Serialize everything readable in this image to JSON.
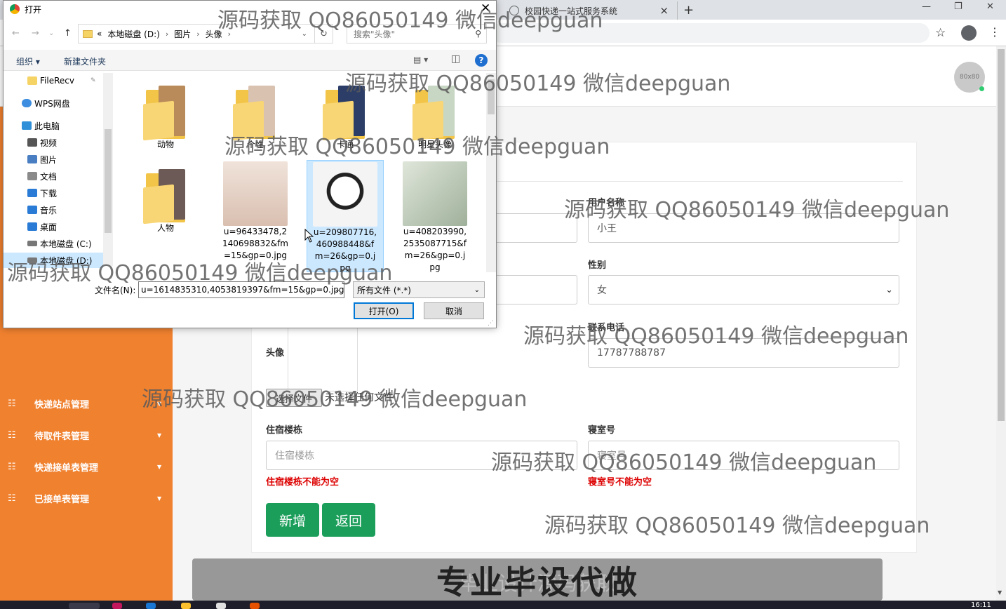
{
  "browser": {
    "tab_title": "校园快递一站式服务系统",
    "close_glyph": "×",
    "new_tab_glyph": "+",
    "min_glyph": "—",
    "max_glyph": "❐",
    "win_close_glyph": "✕",
    "star_glyph": "☆",
    "menu_glyph": "⋮"
  },
  "header": {
    "avatar_text": "80x80"
  },
  "sidebar": {
    "items": [
      {
        "label": "快递站点管理",
        "icon": "grid-icon"
      },
      {
        "label": "待取件表管理",
        "icon": "grid-icon"
      },
      {
        "label": "快递接单表管理",
        "icon": "grid-icon"
      },
      {
        "label": "已接单表管理",
        "icon": "grid-icon"
      }
    ],
    "item_glyph": "☷",
    "caret_glyph": "▼"
  },
  "form": {
    "username_label": "用户名称",
    "username_value": "小王",
    "gender_label": "性别",
    "gender_value": "女",
    "phone_label": "联系电话",
    "phone_value": "17787788787",
    "avatar_label": "头像",
    "choose_file": "选择文件",
    "no_file": "未选择任何文件",
    "building_label": "住宿楼栋",
    "building_placeholder": "住宿楼栋",
    "building_error": "住宿楼栋不能为空",
    "room_label": "寝室号",
    "room_placeholder": "寝室号",
    "room_error": "寝室号不能为空",
    "add_button": "新增",
    "back_button": "返回",
    "select_chevron": "⌄"
  },
  "banner": {
    "text": "专业毕设代做",
    "ghost": "毕业设计源码获取"
  },
  "taskbar": {
    "clock": "16:11",
    "accent": "#1e1e2a"
  },
  "dialog": {
    "title": "打开",
    "close_glyph": "✕",
    "nav": {
      "back": "←",
      "forward": "→",
      "recent": "⌄",
      "up": "↑"
    },
    "path": [
      "本地磁盘 (D:)",
      "图片",
      "头像"
    ],
    "path_prefix": "«",
    "path_sep": "›",
    "refresh_glyph": "↻",
    "search_placeholder": "搜索\"头像\"",
    "search_glyph": "⚲",
    "toolbar": {
      "organize": "组织 ▾",
      "new_folder": "新建文件夹",
      "view_glyph": "▤ ▾",
      "pane_glyph": "◫",
      "help": "?"
    },
    "nav_items": [
      {
        "label": "FileRecv",
        "icon": "folder-icon",
        "color": "#f6d365",
        "pin": "📌"
      },
      {
        "label": "WPS网盘",
        "icon": "cloud-icon",
        "color": "#3d8ee0"
      },
      {
        "label": "此电脑",
        "icon": "computer-icon",
        "color": "#2f8fd8"
      },
      {
        "label": "视频",
        "icon": "video-icon",
        "color": "#555"
      },
      {
        "label": "图片",
        "icon": "pictures-icon",
        "color": "#4a7ec2"
      },
      {
        "label": "文档",
        "icon": "document-icon",
        "color": "#8a8a8a"
      },
      {
        "label": "下载",
        "icon": "download-icon",
        "color": "#2a7bd6"
      },
      {
        "label": "音乐",
        "icon": "music-icon",
        "color": "#2a7bd6"
      },
      {
        "label": "桌面",
        "icon": "desktop-icon",
        "color": "#2a7bd6"
      },
      {
        "label": "本地磁盘 (C:)",
        "icon": "drive-icon",
        "color": "#777"
      },
      {
        "label": "本地磁盘 (D:)",
        "icon": "drive-icon",
        "color": "#777"
      }
    ],
    "files": [
      {
        "name": "动物",
        "kind": "folder",
        "photo": "#b98a5a"
      },
      {
        "name": "个性",
        "kind": "folder",
        "photo": "#d9c2b0"
      },
      {
        "name": "卡通",
        "kind": "folder",
        "photo": "#2c3e68"
      },
      {
        "name": "明星头像",
        "kind": "folder",
        "photo": "#c8d6c4"
      },
      {
        "name": "人物",
        "kind": "folder",
        "photo": "#6b5a55"
      },
      {
        "name": "u=96433478,2140698832&fm=15&gp=0.jpg",
        "kind": "image",
        "photo": "#e8d8cf"
      },
      {
        "name": "u=209807716,460988448&fm=26&gp=0.jpg",
        "kind": "image",
        "photo": "#f4f4f4"
      },
      {
        "name": "u=408203990,2535087715&fm=26&gp=0.jpg",
        "kind": "image",
        "photo": "#b9c7b2"
      }
    ],
    "scroll_down_glyph": "⌄",
    "filename_label": "文件名(N):",
    "filename_value": "u=1614835310,4053819397&fm=15&gp=0.jpg",
    "filetype_value": "所有文件 (*.*)",
    "dropdown_glyph": "⌄",
    "open_button": "打开(O)",
    "cancel_button": "取消",
    "grip_glyph": "⋰"
  },
  "watermark": "源码获取 QQ86050149 微信deepguan"
}
